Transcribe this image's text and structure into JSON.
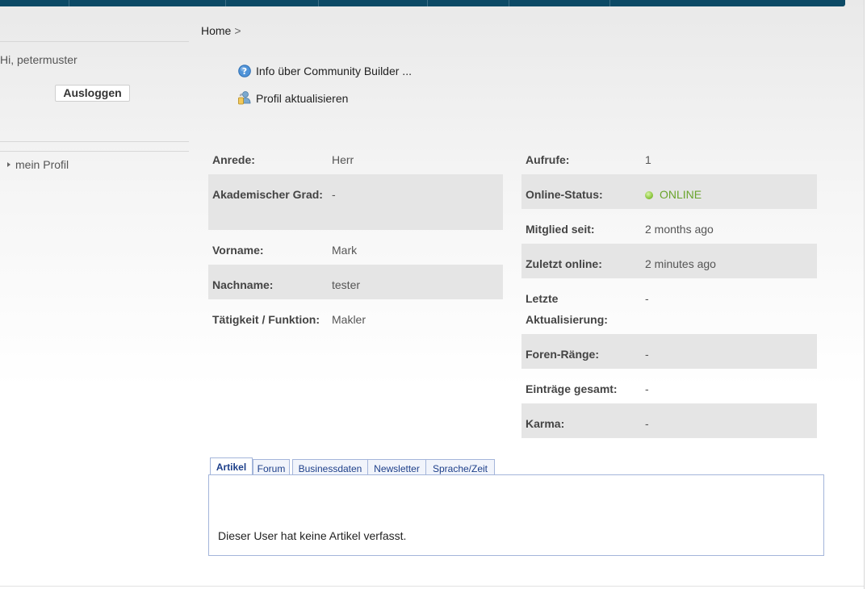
{
  "sidebar": {
    "greeting": "Hi, petermuster",
    "logout_label": "Ausloggen",
    "menu_items": [
      {
        "label": "mein Profil"
      }
    ]
  },
  "breadcrumb": {
    "home": "Home",
    "separator": ">"
  },
  "actions": [
    {
      "label": "Info über Community Builder ...",
      "icon": "help-icon"
    },
    {
      "label": "Profil aktualisieren",
      "icon": "user-edit-icon"
    }
  ],
  "profile_left": [
    {
      "label": "Anrede:",
      "value": "Herr"
    },
    {
      "label": "Akademischer Grad:",
      "value": "-"
    },
    {
      "label": "Vorname:",
      "value": "Mark"
    },
    {
      "label": "Nachname:",
      "value": "tester"
    },
    {
      "label": "Tätigkeit / Funktion:",
      "value": "Makler"
    }
  ],
  "profile_right": [
    {
      "label": "Aufrufe:",
      "value": "1"
    },
    {
      "label": "Online-Status:",
      "value": "ONLINE"
    },
    {
      "label": "Mitglied seit:",
      "value": "2 months ago"
    },
    {
      "label": "Zuletzt online:",
      "value": "2 minutes ago"
    },
    {
      "label": "Letzte Aktualisierung:",
      "value": "-"
    },
    {
      "label": "Foren-Ränge:",
      "value": "-"
    },
    {
      "label": "Einträge gesamt:",
      "value": "-"
    },
    {
      "label": "Karma:",
      "value": "-"
    }
  ],
  "tabs": [
    {
      "label": "Artikel",
      "active": true
    },
    {
      "label": "Forum",
      "active": false
    },
    {
      "label": "Businessdaten",
      "active": false
    },
    {
      "label": "Newsletter",
      "active": false
    },
    {
      "label": "Sprache/Zeit",
      "active": false
    }
  ],
  "tab_content": {
    "text": "Dieser User hat keine Artikel verfasst."
  },
  "colors": {
    "nav": "#0c4a66",
    "online": "#6aa42c",
    "tab_border": "#a4b5da",
    "row_shade": "#e5e5e5"
  }
}
